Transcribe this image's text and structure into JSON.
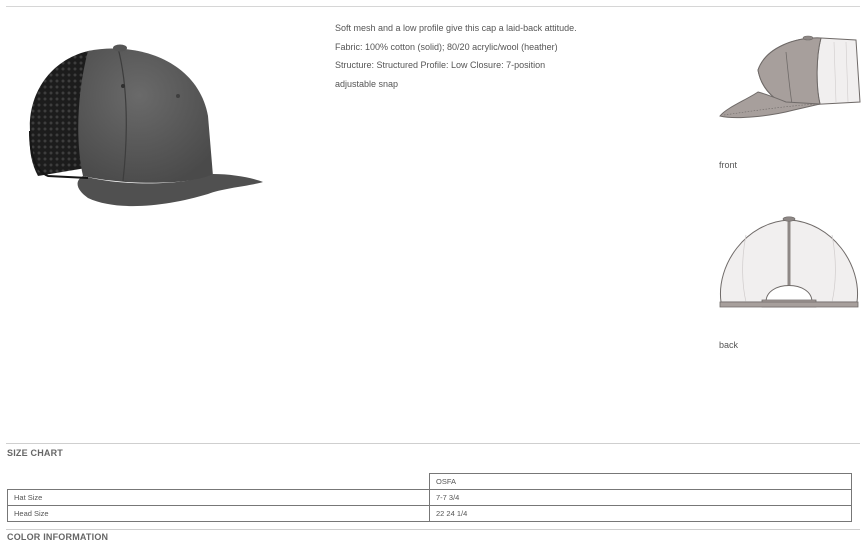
{
  "description": [
    "Soft mesh and a low profile give this cap a laid-back attitude.",
    "Fabric: 100% cotton (solid); 80/20 acrylic/wool (heather)",
    "Structure: Structured Profile: Low Closure: 7-position",
    "adjustable snap"
  ],
  "thumbnails": {
    "front": {
      "label": "front"
    },
    "back": {
      "label": "back"
    }
  },
  "size_chart": {
    "title": "SIZE CHART",
    "columns": [
      "OSFA"
    ],
    "rows": [
      {
        "label": "Hat Size",
        "value": "7-7 3/4"
      },
      {
        "label": "Head Size",
        "value": "22 24 1/4"
      }
    ]
  },
  "color_information": {
    "title": "COLOR INFORMATION"
  },
  "colors": {
    "heather_crown": "#5e5e5e",
    "mesh": "#2a2a2a",
    "sketch_fill": "#a79f9c",
    "sketch_mesh": "#f1efef",
    "sketch_outline": "#6f6a68"
  }
}
